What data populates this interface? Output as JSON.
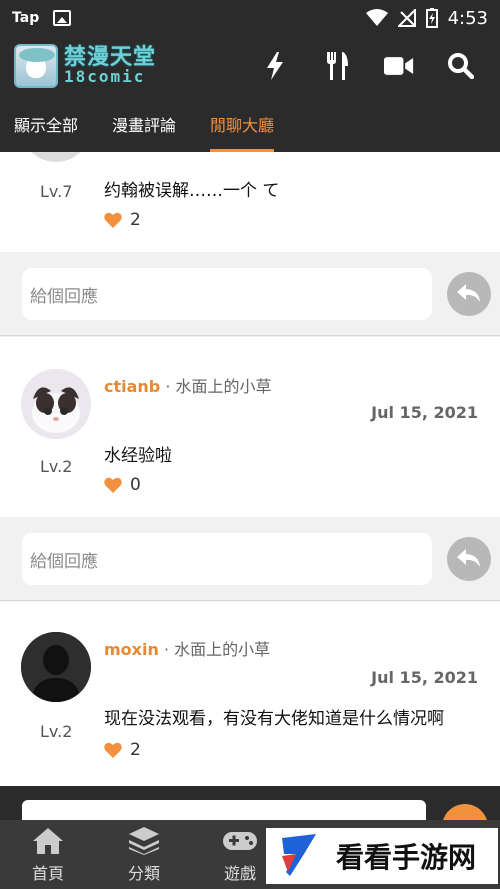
{
  "status_bar": {
    "app_name": "Tap",
    "time": "4:53"
  },
  "app_bar": {
    "logo_line1": "禁漫天堂",
    "logo_line2": "18comic",
    "actions": [
      "lightning-icon",
      "utensils-icon",
      "video-icon",
      "search-icon"
    ]
  },
  "tabs": [
    {
      "label": "顯示全部",
      "active": false
    },
    {
      "label": "漫畫評論",
      "active": false
    },
    {
      "label": "閒聊大廳",
      "active": true
    }
  ],
  "comments": [
    {
      "level": "Lv.7",
      "text": "约翰被误解……一个 て",
      "likes": "2"
    },
    {
      "username": "ctianb",
      "separator": "·",
      "group": "水面上的小草",
      "date": "Jul 15, 2021",
      "level": "Lv.2",
      "text": "水经验啦",
      "likes": "0"
    },
    {
      "username": "moxin",
      "separator": "·",
      "group": "水面上的小草",
      "date": "Jul 15, 2021",
      "level": "Lv.2",
      "text": "现在没法观看，有没有大佬知道是什么情况啊",
      "likes": "2"
    }
  ],
  "reply_placeholder": "給個回應",
  "bottom_nav": [
    {
      "label": "首頁",
      "icon": "home-icon"
    },
    {
      "label": "分類",
      "icon": "layers-icon"
    },
    {
      "label": "遊戲",
      "icon": "gamepad-icon"
    }
  ],
  "watermark": {
    "text": "看看手游网"
  },
  "colors": {
    "accent": "#f2913d",
    "bar": "#2b2b2b",
    "heart": "#f2913d"
  }
}
